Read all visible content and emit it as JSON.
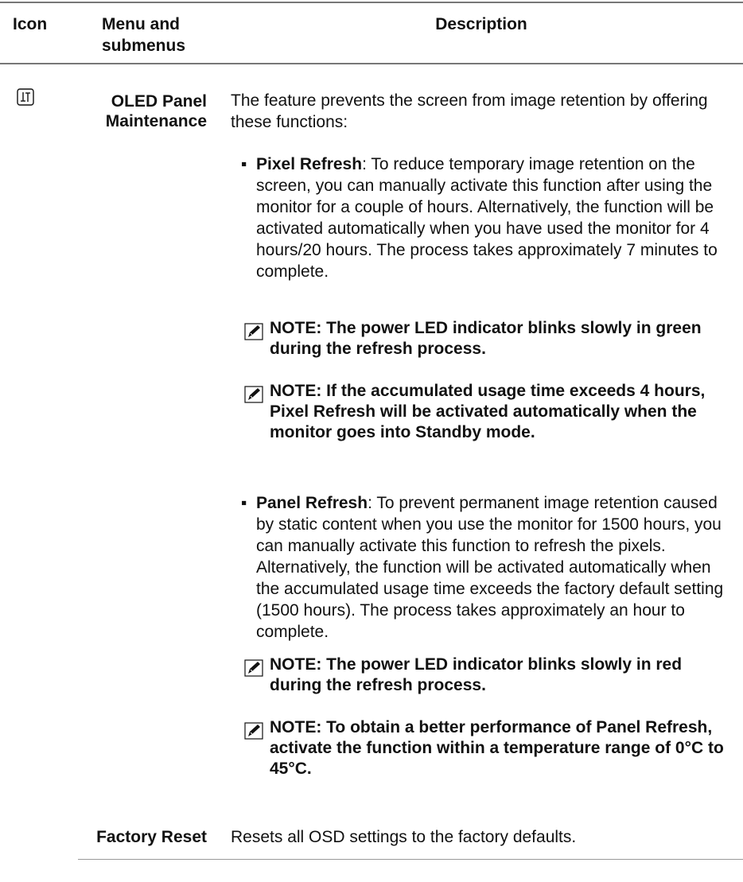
{
  "header": {
    "icon": "Icon",
    "menu": "Menu and submenus",
    "description": "Description"
  },
  "rows": [
    {
      "icon": "osd-others-icon",
      "menu": "OLED Panel Maintenance",
      "intro": "The feature prevents the screen from image retention by offering these functions:",
      "bullets": [
        {
          "term": "Pixel Refresh",
          "text": ": To reduce temporary image retention on the screen, you can manually activate this function after using the monitor for a couple of hours. Alternatively, the function will be activated automatically when you have used the monitor for 4 hours/20 hours. The process takes approximately 7 minutes to complete."
        },
        {
          "term": "Panel Refresh",
          "text": ": To prevent permanent image retention caused by static content when you use the monitor for 1500 hours, you can manually activate this function to refresh the pixels. Alternatively, the function will be activated automatically when the accumulated usage time exceeds the factory default setting (1500 hours). The process takes approximately an hour to complete."
        }
      ],
      "notes": [
        "NOTE: The power LED indicator blinks slowly in green during the refresh process.",
        "NOTE: If the accumulated usage time exceeds 4 hours, Pixel Refresh will be activated automatically when the monitor goes into Standby mode.",
        "NOTE: The power LED indicator blinks slowly in red during the refresh process.",
        "NOTE: To obtain a better performance of Panel Refresh, activate the function within a temperature range of 0°C to 45°C."
      ]
    },
    {
      "menu": "Factory Reset",
      "intro": "Resets all OSD settings to the factory defaults."
    }
  ],
  "bullet_glyph": "▪",
  "note_icon": "pencil-note-icon"
}
